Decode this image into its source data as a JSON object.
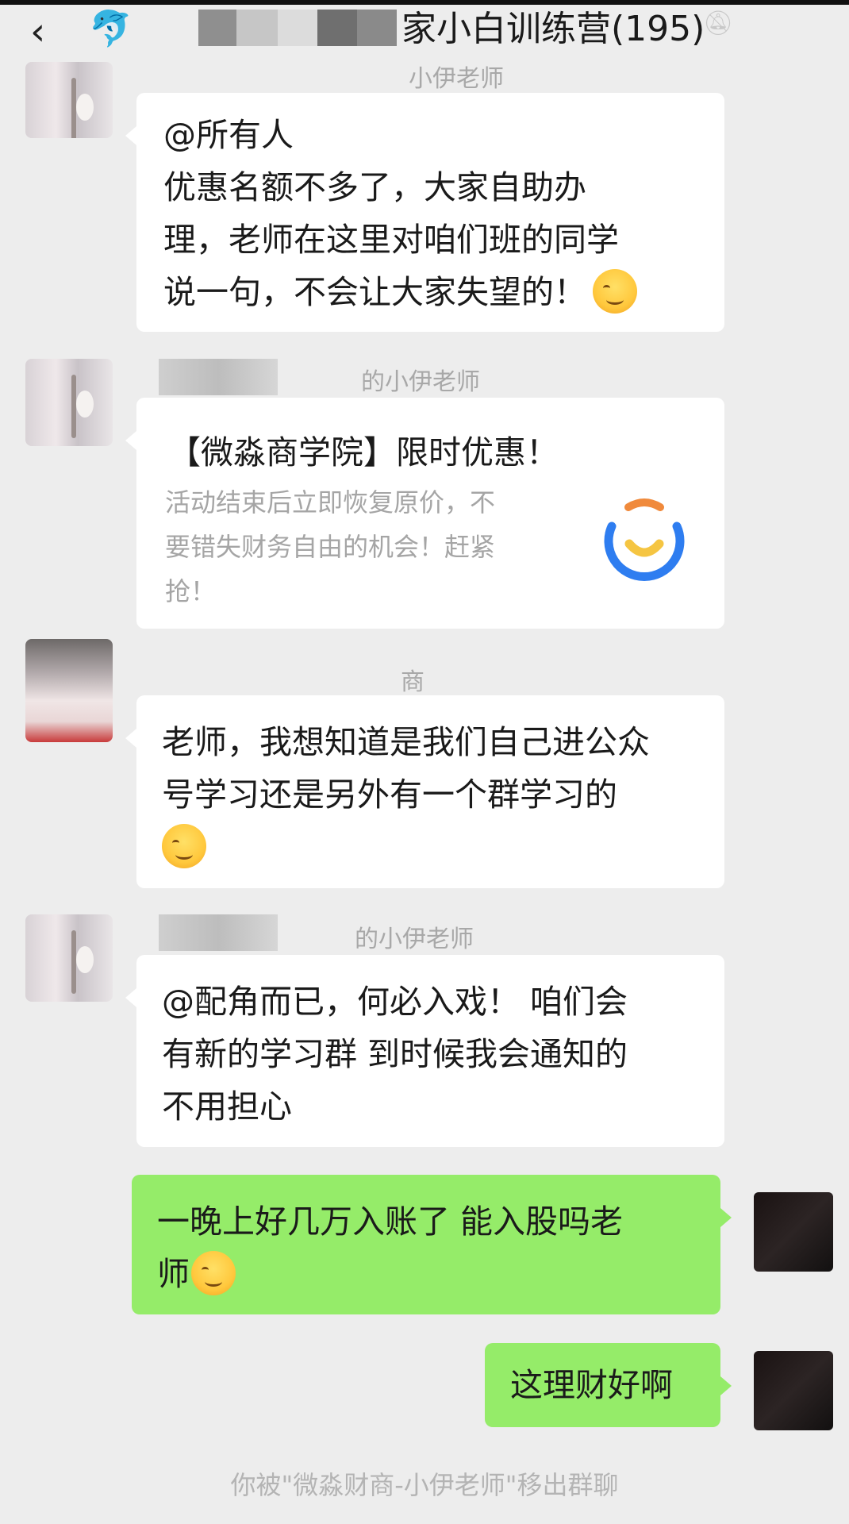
{
  "header": {
    "title": "家小白训练营(195)"
  },
  "messages": [
    {
      "sender": "小伊老师",
      "lines": [
        "@所有人",
        "优惠名额不多了，大家自助办",
        "理，老师在这里对咱们班的同学",
        "说一句，不会让大家失望的！"
      ]
    },
    {
      "sender": "的小伊老师",
      "card": {
        "title": "【微淼商学院】限时优惠！",
        "desc": [
          "活动结束后立即恢复原价，不",
          "要错失财务自由的机会！赶紧",
          "抢！"
        ]
      }
    },
    {
      "sender": "商",
      "lines": [
        "老师，我想知道是我们自己进公众",
        "号学习还是另外有一个群学习的"
      ]
    },
    {
      "sender": "的小伊老师",
      "lines": [
        "@配角而已，何必入戏！  咱们会",
        "有新的学习群 到时候我会通知的",
        "不用担心"
      ]
    },
    {
      "self": true,
      "lines": [
        "一晚上好几万入账了   能入股吗老",
        "师"
      ]
    },
    {
      "self": true,
      "lines": [
        "这理财好啊"
      ]
    }
  ],
  "system": {
    "text": "你被\"微淼财商-小伊老师\"移出群聊"
  },
  "icons": {
    "back": "back-chevron-icon",
    "group": "dolphin-avatar-icon",
    "mute": "mute-bell-icon",
    "emoji_smile": "smiling-face-emoji",
    "emoji_cry": "crying-face-emoji",
    "emoji_tears": "tears-of-joy-emoji",
    "card_logo": "weimiao-logo-icon"
  },
  "colors": {
    "background": "#ededed",
    "bubble_self": "#95ec69",
    "bubble_other": "#ffffff",
    "logo_blue": "#2e7df0",
    "logo_orange": "#f08a3c",
    "logo_yellow": "#f5c542"
  }
}
